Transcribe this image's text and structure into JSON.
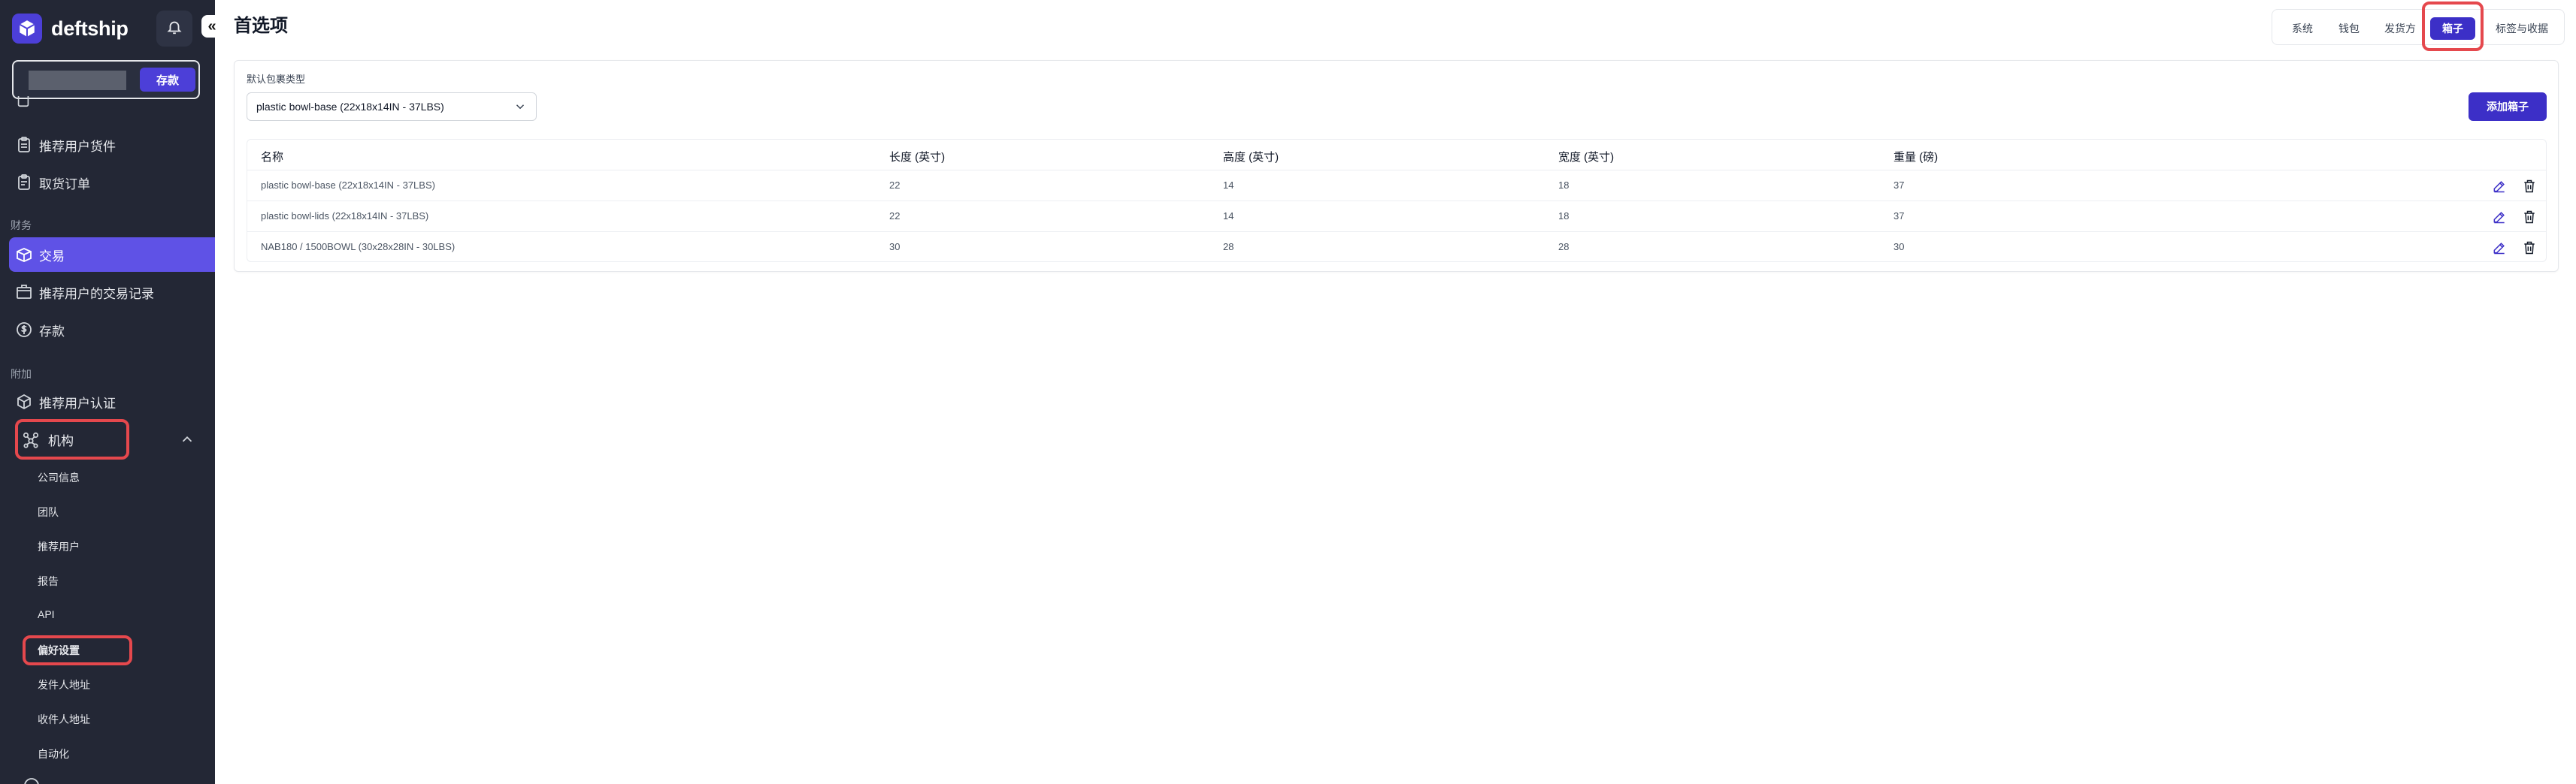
{
  "brand": {
    "name": "deftship",
    "accent": "#4c3fd8"
  },
  "sidebar": {
    "deposit_button": "存款",
    "items_top": [
      {
        "label": "推荐用户货件",
        "icon": "clipboard-icon"
      },
      {
        "label": "取货订单",
        "icon": "clipboard-list-icon"
      }
    ],
    "section_finance": "财务",
    "finance_items": [
      {
        "label": "交易",
        "icon": "box-icon",
        "active": true
      },
      {
        "label": "推荐用户的交易记录",
        "icon": "box-icon"
      },
      {
        "label": "存款",
        "icon": "dollar-circle-icon"
      }
    ],
    "section_extra": "附加",
    "extra_items": [
      {
        "label": "推荐用户认证",
        "icon": "cube-icon"
      },
      {
        "label": "机构",
        "icon": "organization-icon",
        "expanded": true
      }
    ],
    "org_subitems": [
      "公司信息",
      "团队",
      "推荐用户",
      "报告",
      "API",
      "偏好设置",
      "发件人地址",
      "收件人地址",
      "自动化"
    ]
  },
  "header": {
    "title": "首选项",
    "tabs": [
      "系统",
      "钱包",
      "发货方",
      "箱子",
      "标签与收据"
    ],
    "active_tab": "箱子"
  },
  "main": {
    "default_box_label": "默认包裹类型",
    "default_box_value": "plastic bowl-base (22x18x14IN - 37LBS)",
    "add_box_button": "添加箱子",
    "columns": [
      "名称",
      "长度 (英寸)",
      "高度 (英寸)",
      "宽度 (英寸)",
      "重量 (磅)"
    ],
    "rows": [
      [
        "plastic bowl-base (22x18x14IN - 37LBS)",
        "22",
        "14",
        "18",
        "37"
      ],
      [
        "plastic bowl-lids (22x18x14IN - 37LBS)",
        "22",
        "14",
        "18",
        "37"
      ],
      [
        "NAB180 / 1500BOWL (30x28x28IN - 30LBS)",
        "30",
        "28",
        "28",
        "30"
      ]
    ]
  }
}
